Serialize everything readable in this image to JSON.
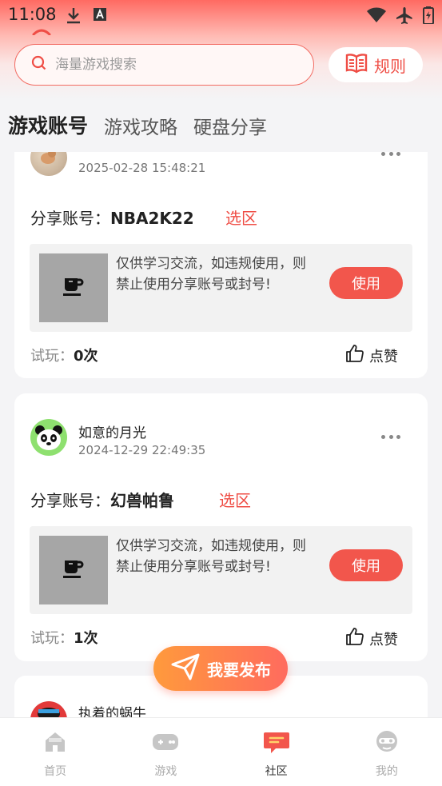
{
  "status_bar": {
    "time": "11:08"
  },
  "search": {
    "placeholder": "海量游戏搜索"
  },
  "rules_button": {
    "label": "规则"
  },
  "tabs": [
    {
      "label": "游戏账号",
      "active": true
    },
    {
      "label": "游戏攻略",
      "active": false
    },
    {
      "label": "硬盘分享",
      "active": false
    }
  ],
  "posts": [
    {
      "username": "",
      "timestamp": "2025-02-28 15:48:21",
      "share_label": "分享账号：",
      "account": "NBA2K22",
      "select_label": "选区",
      "notice": "仅供学习交流，如违规使用，则禁止使用分享账号或封号!",
      "use_label": "使用",
      "trial_label": "试玩：",
      "trial_count": "0次",
      "like_label": "点赞"
    },
    {
      "username": "如意的月光",
      "timestamp": "2024-12-29 22:49:35",
      "share_label": "分享账号：",
      "account": "幻兽帕鲁",
      "select_label": "选区",
      "notice": "仅供学习交流，如违规使用，则禁止使用分享账号或封号!",
      "use_label": "使用",
      "trial_label": "试玩：",
      "trial_count": "1次",
      "like_label": "点赞"
    },
    {
      "username": "执着的蜗牛"
    }
  ],
  "publish_button": {
    "label": "我要发布"
  },
  "bottom_nav": [
    {
      "label": "首页",
      "icon": "home-icon",
      "active": false
    },
    {
      "label": "游戏",
      "icon": "gamepad-icon",
      "active": false
    },
    {
      "label": "社区",
      "icon": "community-icon",
      "active": true
    },
    {
      "label": "我的",
      "icon": "profile-icon",
      "active": false
    }
  ],
  "colors": {
    "accent": "#ef4d45",
    "publish_start": "#ff9a3c",
    "publish_end": "#ff6b5e"
  }
}
